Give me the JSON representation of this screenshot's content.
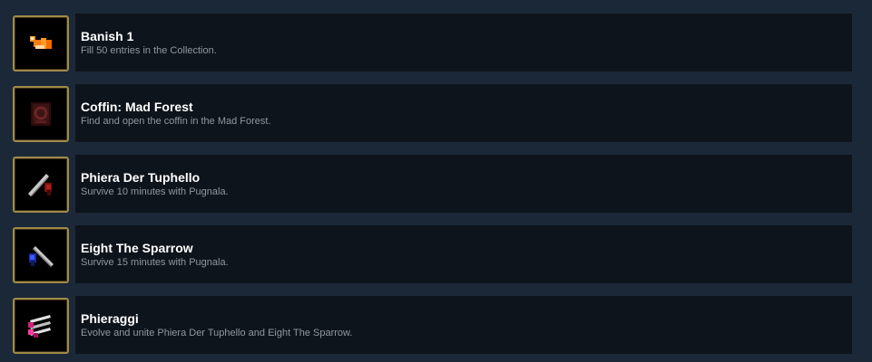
{
  "achievements": [
    {
      "title": "Banish 1",
      "description": "Fill 50 entries in the Collection.",
      "icon": "banish-scroll-icon"
    },
    {
      "title": "Coffin: Mad Forest",
      "description": "Find and open the coffin in the Mad Forest.",
      "icon": "coffin-icon"
    },
    {
      "title": "Phiera Der Tuphello",
      "description": "Survive 10 minutes with Pugnala.",
      "icon": "red-gun-icon"
    },
    {
      "title": "Eight The Sparrow",
      "description": "Survive 15 minutes with Pugnala.",
      "icon": "blue-gun-icon"
    },
    {
      "title": "Phieraggi",
      "description": "Evolve and unite Phiera Der Tuphello and Eight The Sparrow.",
      "icon": "phieraggi-icon"
    }
  ],
  "colors": {
    "background": "#1b2838",
    "row": "#0e141b",
    "frame": "#a08a4a",
    "title": "#ffffff",
    "description": "#8f98a0"
  }
}
